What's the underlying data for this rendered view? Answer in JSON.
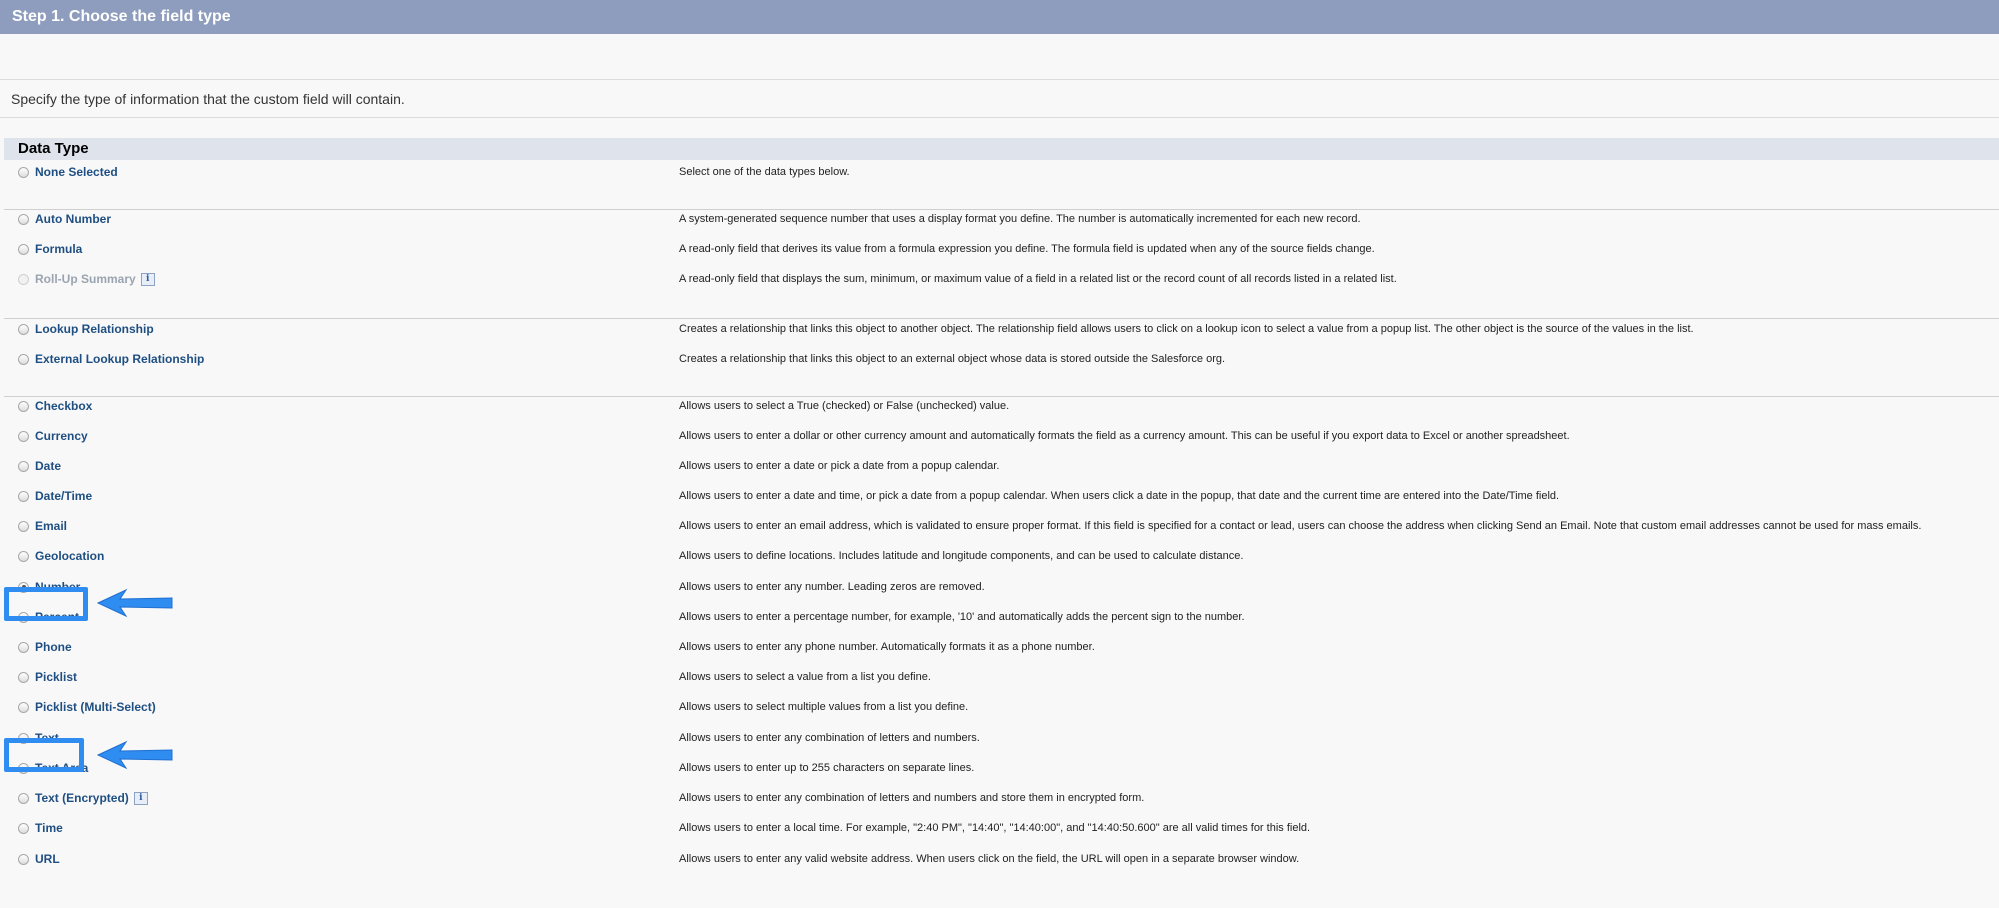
{
  "step_header": "Step 1. Choose the field type",
  "intro": "Specify the type of information that the custom field will contain.",
  "data_type_header": "Data Type",
  "colors": {
    "header_bg": "#8e9dbe",
    "link": "#1f4f82",
    "highlight": "#2f8cf0"
  },
  "selected": "Number",
  "options": [
    {
      "label": "None Selected",
      "desc": "Select one of the data types below.",
      "checked": false,
      "disabled": false,
      "info": false
    },
    {
      "label": "Auto Number",
      "desc": "A system-generated sequence number that uses a display format you define. The number is automatically incremented for each new record.",
      "checked": false,
      "disabled": false,
      "info": false
    },
    {
      "label": "Formula",
      "desc": "A read-only field that derives its value from a formula expression you define. The formula field is updated when any of the source fields change.",
      "checked": false,
      "disabled": false,
      "info": false
    },
    {
      "label": "Roll-Up Summary",
      "desc": "A read-only field that displays the sum, minimum, or maximum value of a field in a related list or the record count of all records listed in a related list.",
      "checked": false,
      "disabled": true,
      "info": true
    },
    {
      "label": "Lookup Relationship",
      "desc": "Creates a relationship that links this object to another object. The relationship field allows users to click on a lookup icon to select a value from a popup list. The other object is the source of the values in the list.",
      "checked": false,
      "disabled": false,
      "info": false
    },
    {
      "label": "External Lookup Relationship",
      "desc": "Creates a relationship that links this object to an external object whose data is stored outside the Salesforce org.",
      "checked": false,
      "disabled": false,
      "info": false
    },
    {
      "label": "Checkbox",
      "desc": "Allows users to select a True (checked) or False (unchecked) value.",
      "checked": false,
      "disabled": false,
      "info": false
    },
    {
      "label": "Currency",
      "desc": "Allows users to enter a dollar or other currency amount and automatically formats the field as a currency amount. This can be useful if you export data to Excel or another spreadsheet.",
      "checked": false,
      "disabled": false,
      "info": false
    },
    {
      "label": "Date",
      "desc": "Allows users to enter a date or pick a date from a popup calendar.",
      "checked": false,
      "disabled": false,
      "info": false
    },
    {
      "label": "Date/Time",
      "desc": "Allows users to enter a date and time, or pick a date from a popup calendar. When users click a date in the popup, that date and the current time are entered into the Date/Time field.",
      "checked": false,
      "disabled": false,
      "info": false
    },
    {
      "label": "Email",
      "desc": "Allows users to enter an email address, which is validated to ensure proper format. If this field is specified for a contact or lead, users can choose the address when clicking Send an Email. Note that custom email addresses cannot be used for mass emails.",
      "checked": false,
      "disabled": false,
      "info": false
    },
    {
      "label": "Geolocation",
      "desc": "Allows users to define locations. Includes latitude and longitude components, and can be used to calculate distance.",
      "checked": false,
      "disabled": false,
      "info": false
    },
    {
      "label": "Number",
      "desc": "Allows users to enter any number. Leading zeros are removed.",
      "checked": true,
      "disabled": false,
      "info": false
    },
    {
      "label": "Percent",
      "desc": "Allows users to enter a percentage number, for example, '10' and automatically adds the percent sign to the number.",
      "checked": false,
      "disabled": false,
      "info": false
    },
    {
      "label": "Phone",
      "desc": "Allows users to enter any phone number. Automatically formats it as a phone number.",
      "checked": false,
      "disabled": false,
      "info": false
    },
    {
      "label": "Picklist",
      "desc": "Allows users to select a value from a list you define.",
      "checked": false,
      "disabled": false,
      "info": false
    },
    {
      "label": "Picklist (Multi-Select)",
      "desc": "Allows users to select multiple values from a list you define.",
      "checked": false,
      "disabled": false,
      "info": false
    },
    {
      "label": "Text",
      "desc": "Allows users to enter any combination of letters and numbers.",
      "checked": false,
      "disabled": false,
      "info": false
    },
    {
      "label": "Text Area",
      "desc": "Allows users to enter up to 255 characters on separate lines.",
      "checked": false,
      "disabled": false,
      "info": false
    },
    {
      "label": "Text (Encrypted)",
      "desc": "Allows users to enter any combination of letters and numbers and store them in encrypted form.",
      "checked": false,
      "disabled": false,
      "info": true
    },
    {
      "label": "Time",
      "desc": "Allows users to enter a local time. For example, \"2:40 PM\", \"14:40\", \"14:40:00\", and \"14:40:50.600\" are all valid times for this field.",
      "checked": false,
      "disabled": false,
      "info": false
    },
    {
      "label": "URL",
      "desc": "Allows users to enter any valid website address. When users click on the field, the URL will open in a separate browser window.",
      "checked": false,
      "disabled": false,
      "info": false
    }
  ]
}
